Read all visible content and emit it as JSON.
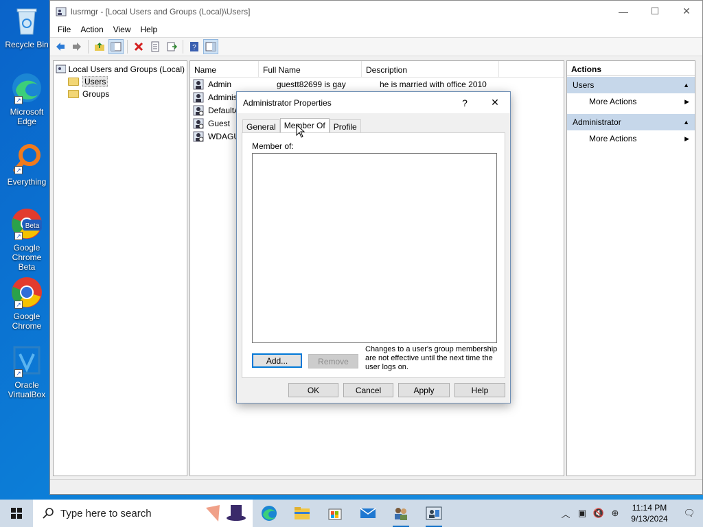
{
  "desktop": {
    "icons": [
      {
        "label": "Recycle Bin"
      },
      {
        "label": "Microsoft Edge"
      },
      {
        "label": "Everything"
      },
      {
        "label": "Google Chrome Beta"
      },
      {
        "label": "Google Chrome"
      },
      {
        "label": "Oracle VirtualBox"
      }
    ]
  },
  "window": {
    "title": "lusrmgr - [Local Users and Groups (Local)\\Users]",
    "menu": [
      "File",
      "Action",
      "View",
      "Help"
    ],
    "tree": {
      "root": "Local Users and Groups (Local)",
      "children": [
        "Users",
        "Groups"
      ]
    },
    "list": {
      "columns": [
        "Name",
        "Full Name",
        "Description"
      ],
      "rows": [
        {
          "name": "Admin",
          "full_name": "guestt82699 is gay",
          "description": "he is married with office 2010"
        },
        {
          "name": "Administ",
          "full_name": "",
          "description": ""
        },
        {
          "name": "DefaultA",
          "full_name": "",
          "description": ""
        },
        {
          "name": "Guest",
          "full_name": "",
          "description": ""
        },
        {
          "name": "WDAGUt",
          "full_name": "",
          "description": ""
        }
      ]
    },
    "actions": {
      "header": "Actions",
      "sections": [
        {
          "title": "Users",
          "item": "More Actions"
        },
        {
          "title": "Administrator",
          "item": "More Actions"
        }
      ]
    }
  },
  "dialog": {
    "title": "Administrator Properties",
    "help_glyph": "?",
    "tabs": [
      "General",
      "Member Of",
      "Profile"
    ],
    "active_tab": "Member Of",
    "member_of_label": "Member of:",
    "add_label": "Add...",
    "remove_label": "Remove",
    "note": "Changes to a user's group membership are not effective until the next time the user logs on.",
    "ok_label": "OK",
    "cancel_label": "Cancel",
    "apply_label": "Apply",
    "help_label": "Help"
  },
  "taskbar": {
    "search_placeholder": "Type here to search",
    "time": "11:14 PM",
    "date": "9/13/2024"
  },
  "colors": {
    "accent": "#0078d7",
    "actions_section_bg": "#c6d7ea",
    "desktop_bg": "#0c7fd8"
  }
}
